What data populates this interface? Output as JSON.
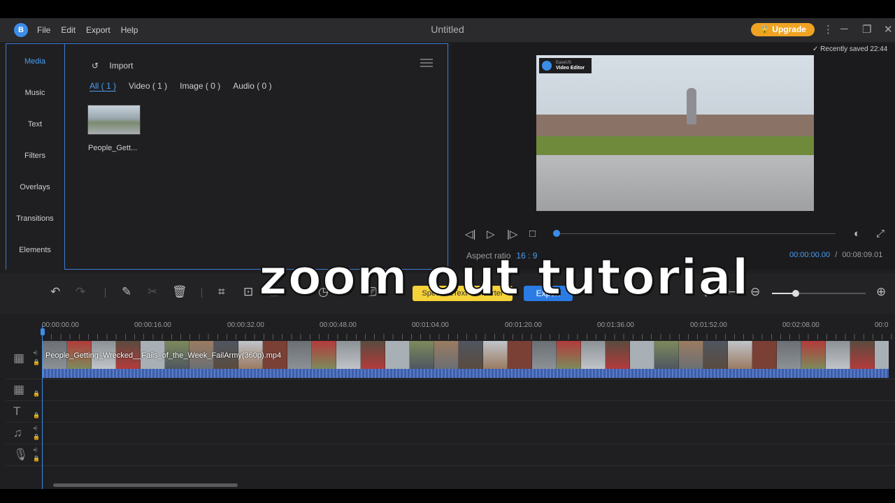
{
  "title_bar": {
    "logo_letter": "B",
    "menu": [
      "File",
      "Edit",
      "Export",
      "Help"
    ],
    "title": "Untitled",
    "upgrade_label": "Upgrade"
  },
  "sidebar": {
    "items": [
      "Media",
      "Music",
      "Text",
      "Filters",
      "Overlays",
      "Transitions",
      "Elements"
    ]
  },
  "media": {
    "import_label": "Import",
    "tabs": [
      "All ( 1 )",
      "Video ( 1 )",
      "Image ( 0 )",
      "Audio ( 0 )"
    ],
    "active_tab": "All ( 1 )",
    "item_label": "People_Gett..."
  },
  "preview": {
    "saved_status": "Recently saved 22:44",
    "badge_brand": "EaseUS",
    "badge_name": "Video Editor",
    "aspect_label": "Aspect ratio",
    "aspect_value": "16 : 9",
    "time_current": "00:00:00.00",
    "time_sep": "/",
    "time_total": "00:08:09.01",
    "progress": 0
  },
  "toolbar": {
    "speech_label": "Speech&Text Converter",
    "export_label": "Export",
    "zoom_level": 0.25
  },
  "timeline": {
    "ticks": [
      "00:00:00.00",
      "00:00:16.00",
      "00:00:32.00",
      "00:00:48.00",
      "00:01:04.00",
      "00:01:20.00",
      "00:01:36.00",
      "00:01:52.00",
      "00:02:08.00",
      "00:0"
    ],
    "clip_label": "People_Getting_Wrecked__Fails_of_the_Week_FailArmy(360p).mp4"
  },
  "overlay_caption": "zoom out tutorial",
  "colors": {
    "accent": "#3b8de8",
    "upgrade": "#f0a322",
    "speech": "#f5d23a",
    "export": "#2b7be4"
  }
}
